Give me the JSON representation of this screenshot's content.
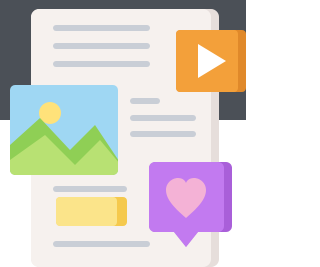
{
  "scene": {
    "background_top_color": "#4b5057",
    "background_bottom_color": "#ffffff",
    "document_color": "#f6f1ee",
    "document_edge_color": "#e6dedb",
    "text_line_color": "#c9ced6",
    "play_tile_color": "#f3a03a",
    "play_tile_shade_color": "#e0892a",
    "play_glyph_color": "#ffffff",
    "photo_sky_color": "#9fd7f3",
    "photo_sun_color": "#ffe27a",
    "photo_hill_front_color": "#b8e173",
    "photo_hill_back_color": "#8fcf55",
    "heart_bubble_color": "#c27af0",
    "heart_bubble_shade_color": "#a95fd9",
    "heart_color": "#f4b2d6",
    "tag_color": "#fbe48a",
    "tag_shade_color": "#f5c94d"
  },
  "icons": {
    "document": "document-icon",
    "video": "play-icon",
    "image": "image-icon",
    "like": "heart-icon",
    "tag": "label-icon"
  }
}
